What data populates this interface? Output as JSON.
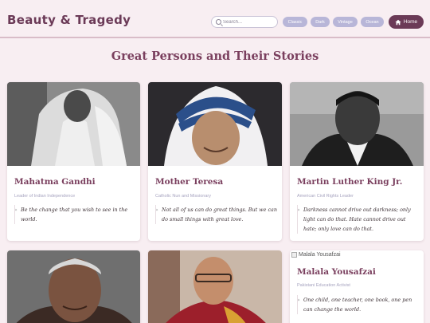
{
  "header": {
    "logo": "Beauty & Tragedy",
    "search_placeholder": "Search...",
    "filters": [
      "Classic",
      "Dark",
      "Vintage",
      "Ocean"
    ],
    "home_label": "Home"
  },
  "page": {
    "title": "Great Persons and Their Stories"
  },
  "cards": [
    {
      "name": "Mahatma Gandhi",
      "role": "Leader of Indian Independence",
      "quote": "Be the change that you wish to see in the world.",
      "image_alt": ""
    },
    {
      "name": "Mother Teresa",
      "role": "Catholic Nun and Missionary",
      "quote": "Not all of us can do great things. But we can do small things with great love.",
      "image_alt": ""
    },
    {
      "name": "Martin Luther King Jr.",
      "role": "American Civil Rights Leader",
      "quote": "Darkness cannot drive out darkness; only light can do that. Hate cannot drive out hate; only love can do that.",
      "image_alt": ""
    },
    {
      "name": "",
      "role": "",
      "quote": "",
      "image_alt": ""
    },
    {
      "name": "",
      "role": "",
      "quote": "",
      "image_alt": ""
    },
    {
      "name": "Malala Yousafzai",
      "role": "Pakistani Education Activist",
      "quote": "One child, one teacher, one book, one pen can change the world.",
      "image_alt": "Malala Yousafzai"
    }
  ],
  "colors": {
    "accent": "#6b3a57",
    "title": "#7a3f5e",
    "filter_pill": "#b8b6d8",
    "background": "#f8eef2"
  },
  "icons": {
    "search": "search-icon",
    "home": "home-icon",
    "quote": "quote-icon",
    "broken_image": "broken-image-icon"
  }
}
